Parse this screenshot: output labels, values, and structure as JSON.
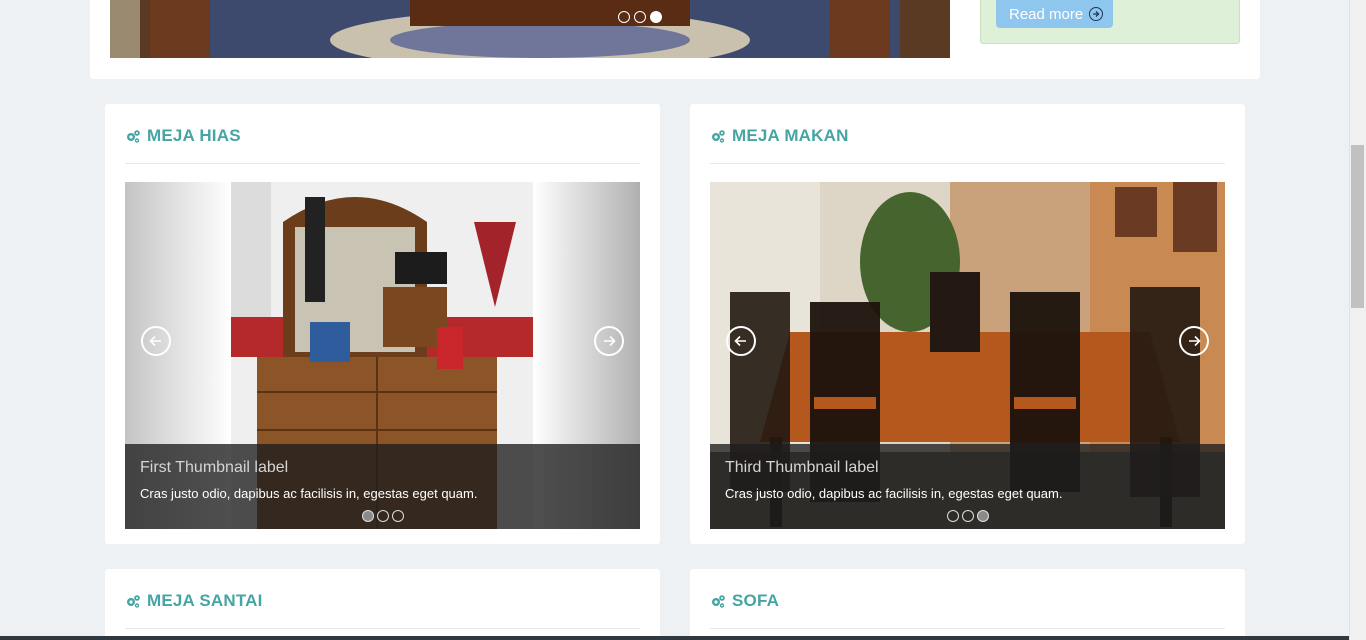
{
  "top": {
    "read_more_label": "Read more",
    "slider_dots": [
      false,
      false,
      true
    ]
  },
  "cards": [
    {
      "title": "MEJA HIAS",
      "caption_title": "First Thumbnail label",
      "caption_text": "Cras justo odio, dapibus ac facilisis in, egestas eget quam.",
      "indicators": [
        true,
        false,
        false
      ]
    },
    {
      "title": "MEJA MAKAN",
      "caption_title": "Third Thumbnail label",
      "caption_text": "Cras justo odio, dapibus ac facilisis in, egestas eget quam.",
      "indicators": [
        false,
        false,
        true
      ]
    },
    {
      "title": "MEJA SANTAI"
    },
    {
      "title": "SOFA"
    }
  ],
  "colors": {
    "accent": "#45a5a3",
    "page_bg": "#eef1f4",
    "read_more_bg": "#8ec6ee",
    "green_box": "#dff0d8"
  },
  "icons": {
    "card_title_icon": "gears-icon",
    "prev_icon": "arrow-left-circle-icon",
    "next_icon": "arrow-right-circle-icon",
    "read_more_icon": "arrow-right-circle-icon"
  }
}
